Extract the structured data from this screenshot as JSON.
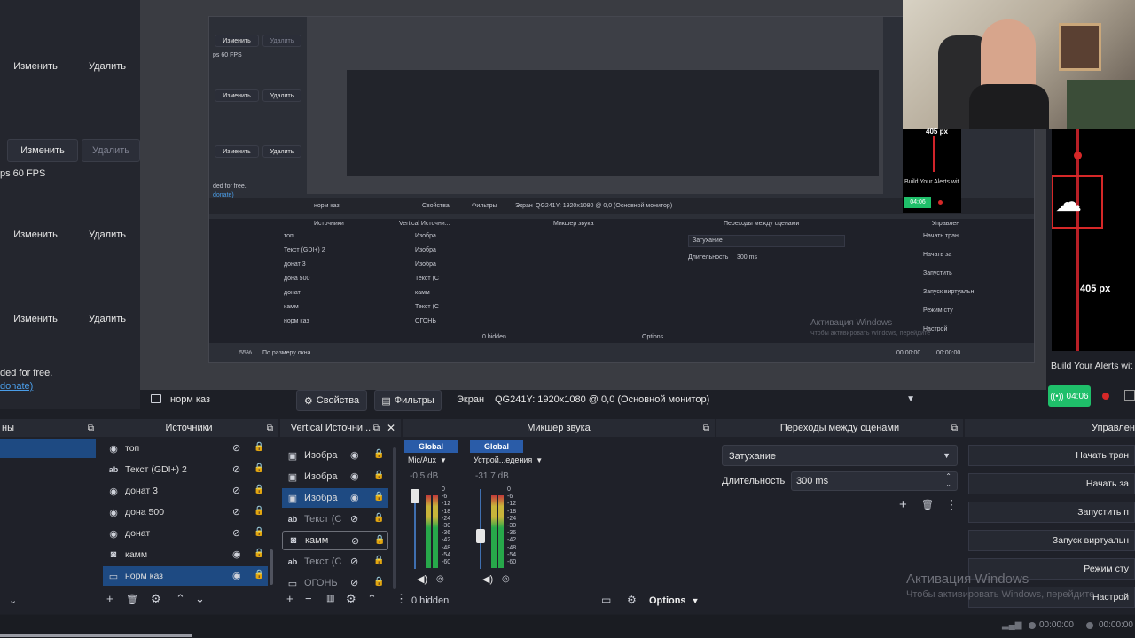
{
  "left_panel": {
    "rows": [
      {
        "edit": "Изменить",
        "delete": "Удалить"
      },
      {
        "edit": "Изменить",
        "delete": "Удалить"
      },
      {
        "edit": "Изменить",
        "delete": "Удалить"
      },
      {
        "edit": "Изменить",
        "delete": "Удалить"
      }
    ],
    "fps_text": "ps 60 FPS",
    "free_text": "ded for free.",
    "donate_text": "donate)"
  },
  "inner_capture": {
    "edit": "Изменить",
    "delete": "Удалить",
    "fps": "ps 60 FPS",
    "free": "ded for free.",
    "donate": "donate)",
    "toolbar": {
      "props": "Свойства",
      "filters": "Фильтры",
      "screen_label": "Экран",
      "screen_value": "QG241Y: 1920x1080 @ 0,0 (Основной монитор)",
      "scene_name": "норм каз"
    },
    "sources_title": "Источники",
    "vertical_title": "Vertical Источни...",
    "mixer_title": "Микшер звука",
    "transitions_title": "Переходы между сценами",
    "controls_title": "Управлен",
    "sources": [
      "топ",
      "Текст (GDI+) 2",
      "донат 3",
      "дона 500",
      "донат",
      "камм",
      "норм каз"
    ],
    "vertical": [
      "Изобра",
      "Изобра",
      "Изобра",
      "Текст (С",
      "камм",
      "Текст (С",
      "ОГОНЬ"
    ],
    "transition": "Затухание",
    "duration_label": "Длительность",
    "duration": "300 ms",
    "hidden": "0 hidden",
    "options": "Options",
    "controls": [
      "Начать тран",
      "Начать за",
      "Запустить",
      "Запуск виртуальн",
      "Режим сту",
      "Настрой"
    ],
    "zoom": "55%",
    "fit": "По размеру окна",
    "activation_title": "Активация Windows",
    "activation_sub": "Чтобы активировать Windows, перейдите",
    "time": "00:00:00"
  },
  "right_column": {
    "px_top": "405 px",
    "px_main": "405 px",
    "alerts_small": "Build Your Alerts wit",
    "alerts": "Build Your Alerts wit",
    "live_small": "04:06",
    "live": "04:06"
  },
  "toolbar": {
    "scene_name": "норм каз",
    "properties": "Свойства",
    "filters": "Фильтры",
    "screen_label": "Экран",
    "screen_value": "QG241Y: 1920x1080 @ 0,0 (Основной монитор)"
  },
  "docks": {
    "scenes_title": "ны",
    "sources_title": "Источники",
    "vertical_title": "Vertical Источни...",
    "mixer_title": "Микшер звука",
    "transitions_title": "Переходы между сценами",
    "controls_title": "Управлен"
  },
  "sources": [
    {
      "icon": "eye-slash",
      "label": "топ",
      "type": "browser"
    },
    {
      "icon": "text",
      "label": "Текст (GDI+) 2",
      "type": "text"
    },
    {
      "icon": "browser",
      "label": "донат 3",
      "type": "browser"
    },
    {
      "icon": "browser",
      "label": "дона 500",
      "type": "browser"
    },
    {
      "icon": "browser",
      "label": "донат",
      "type": "browser"
    },
    {
      "icon": "camera",
      "label": "камм",
      "type": "camera"
    },
    {
      "icon": "monitor",
      "label": "норм каз",
      "type": "display"
    }
  ],
  "vertical_sources": [
    {
      "label": "Изобра"
    },
    {
      "label": "Изобра"
    },
    {
      "label": "Изобра"
    },
    {
      "label": "Текст (С"
    },
    {
      "label": "камм"
    },
    {
      "label": "Текст (С"
    },
    {
      "label": "ОГОНЬ"
    }
  ],
  "mixer": {
    "channels": [
      {
        "badge": "Global",
        "name": "Mic/Aux",
        "db": "-0.5 dB"
      },
      {
        "badge": "Global",
        "name": "Устрой...едения",
        "db": "-31.7 dB"
      }
    ],
    "ticks": [
      "0",
      "-6",
      "-12",
      "-18",
      "-24",
      "-30",
      "-36",
      "-42",
      "-48",
      "-54",
      "-60"
    ],
    "hidden": "0 hidden",
    "options": "Options"
  },
  "transitions": {
    "type": "Затухание",
    "duration_label": "Длительность",
    "duration_value": "300 ms"
  },
  "controls": [
    "Начать тран",
    "Начать за",
    "Запустить п",
    "Запуск виртуальн",
    "Режим сту",
    "Настрой"
  ],
  "watermark": {
    "title": "Активация Windows",
    "subtitle": "Чтобы активировать Windows, перейдите"
  },
  "status": {
    "rec_time": "00:00:00",
    "stream_time": "00:00:00"
  },
  "colors": {
    "accent": "#1e4a82",
    "live_green": "#1fbf6a",
    "rec_red": "#d62828",
    "mixer_badge": "#2a5ca8"
  }
}
